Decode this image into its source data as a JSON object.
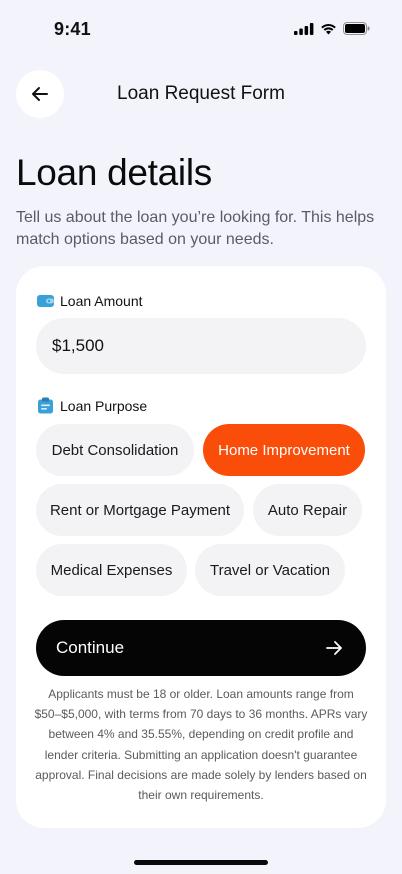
{
  "status": {
    "time": "9:41"
  },
  "header": {
    "title": "Loan Request Form"
  },
  "page": {
    "title": "Loan details",
    "subtitle": "Tell us about the loan you’re looking for. This helps match options based on your needs."
  },
  "form": {
    "amount_label": "Loan Amount",
    "amount_value": "$1,500",
    "purpose_label": "Loan Purpose",
    "purpose_options": [
      "Debt Consolidation",
      "Home Improvement",
      "Rent or Mortgage Payment",
      "Auto Repair",
      "Medical Expenses",
      "Travel or Vacation"
    ],
    "selected_purpose": "Home Improvement",
    "continue_label": "Continue",
    "disclaimer": "Applicants must be 18 or older. Loan amounts range from $50–$5,000, with terms from 70 days to 36 months. APRs vary between 4% and 35.55%, depending on credit profile and lender criteria. Submitting an application doesn't guarantee approval. Final decisions are made solely by lenders based on their own requirements."
  },
  "colors": {
    "accent": "#fa4d0a",
    "background": "#f3f3fc",
    "button": "#050505",
    "icon_blue": "#3aa0d8"
  },
  "icons": {
    "back": "arrow-left-icon",
    "amount": "wallet-icon",
    "purpose": "clipboard-icon",
    "continue": "arrow-right-icon"
  }
}
